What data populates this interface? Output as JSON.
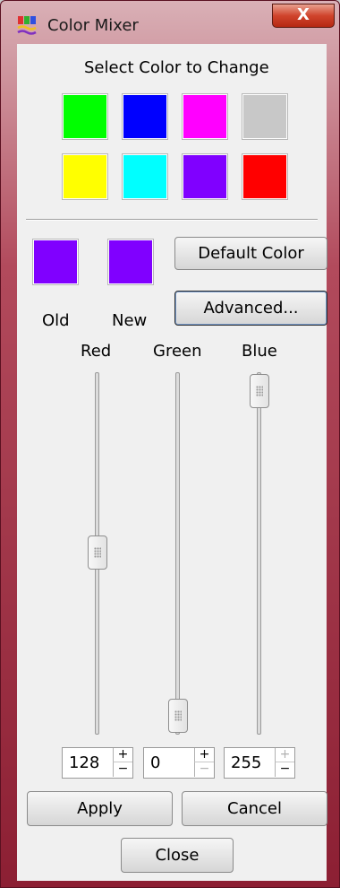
{
  "window": {
    "title": "Color Mixer",
    "close_symbol": "X"
  },
  "palette": {
    "heading": "Select Color to Change",
    "swatches": [
      "#00ff00",
      "#0000ff",
      "#ff00ff",
      "#c8c8c8",
      "#ffff00",
      "#00ffff",
      "#8000ff",
      "#ff0000"
    ]
  },
  "preview": {
    "old_label": "Old",
    "new_label": "New",
    "old_color": "#8000ff",
    "new_color": "#8000ff"
  },
  "buttons": {
    "default_color": "Default Color",
    "advanced": "Advanced...",
    "apply": "Apply",
    "cancel": "Cancel",
    "close": "Close"
  },
  "channels": [
    {
      "label": "Red",
      "value": "128",
      "level": 128
    },
    {
      "label": "Green",
      "value": "0",
      "level": 0
    },
    {
      "label": "Blue",
      "value": "255",
      "level": 255
    }
  ],
  "spin": {
    "up": "+",
    "down": "−"
  }
}
